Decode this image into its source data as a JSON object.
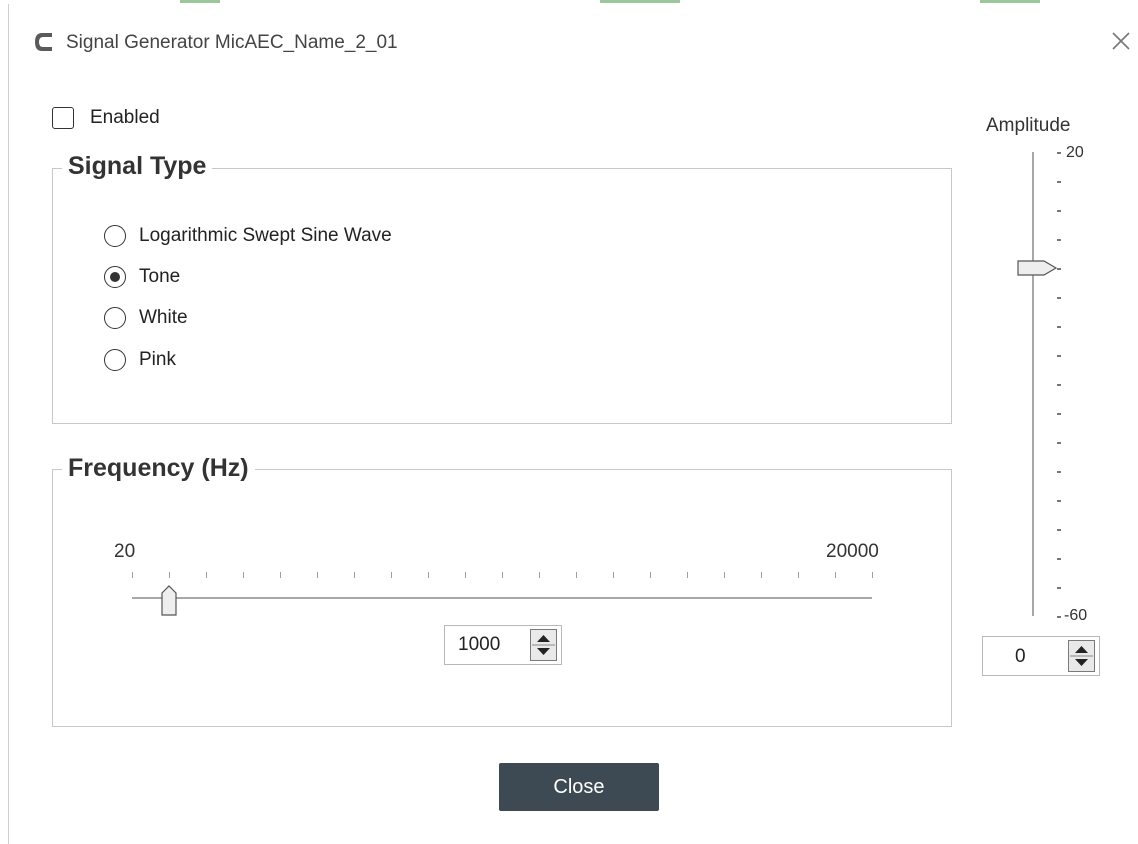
{
  "dialog": {
    "title": "Signal Generator MicAEC_Name_2_01",
    "logo_icon": "brand-c-logo-icon",
    "close_icon": "close-icon"
  },
  "enabled": {
    "label": "Enabled",
    "checked": false
  },
  "signal_type": {
    "legend": "Signal Type",
    "options": [
      {
        "label": "Logarithmic Swept Sine Wave",
        "selected": false
      },
      {
        "label": "Tone",
        "selected": true
      },
      {
        "label": "White",
        "selected": false
      },
      {
        "label": "Pink",
        "selected": false
      }
    ]
  },
  "frequency": {
    "legend": "Frequency (Hz)",
    "min_label": "20",
    "max_label": "20000",
    "value": "1000"
  },
  "amplitude": {
    "label": "Amplitude",
    "max_label": "20",
    "min_label": "-60",
    "value": "0"
  },
  "footer": {
    "close_label": "Close"
  },
  "colors": {
    "accent_dark": "#3d4a53",
    "border": "#c8c8c8"
  }
}
